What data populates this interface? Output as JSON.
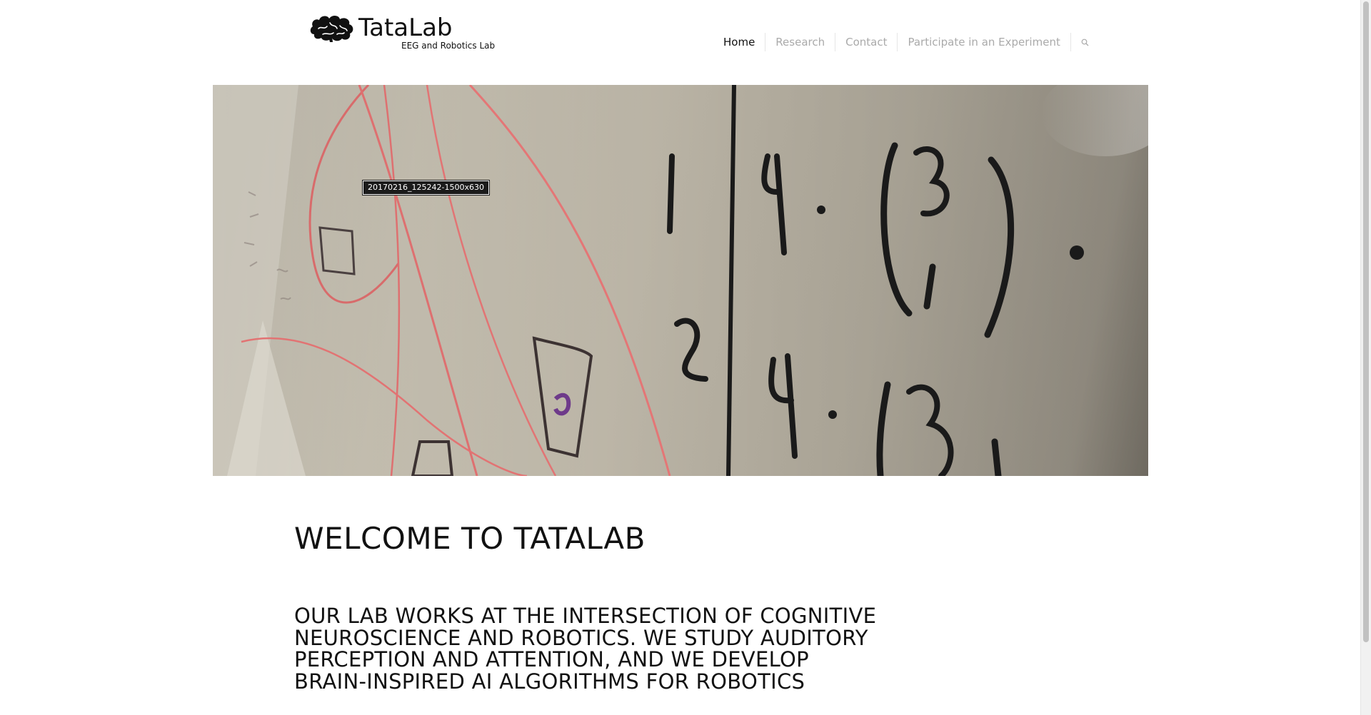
{
  "header": {
    "logo": {
      "title": "TataLab",
      "subtitle": "EEG and Robotics Lab",
      "icon": "brain-icon"
    },
    "nav": {
      "items": [
        {
          "label": "Home",
          "active": true
        },
        {
          "label": "Research",
          "active": false
        },
        {
          "label": "Contact",
          "active": false
        },
        {
          "label": "Participate in an Experiment",
          "active": false
        }
      ],
      "search_icon": "search-icon"
    }
  },
  "hero": {
    "tooltip": "20170216_125242-1500x630"
  },
  "main": {
    "welcome": "WELCOME TO TATALAB",
    "intro": "OUR LAB WORKS AT THE INTERSECTION OF COGNITIVE NEUROSCIENCE AND ROBOTICS. WE STUDY AUDITORY PERCEPTION AND ATTENTION, AND WE DEVELOP BRAIN-INSPIRED AI ALGORITHMS FOR ROBOTICS"
  },
  "colors": {
    "text": "#111111",
    "nav_inactive": "#aaaaaa",
    "nav_active": "#111111",
    "background": "#ffffff"
  }
}
